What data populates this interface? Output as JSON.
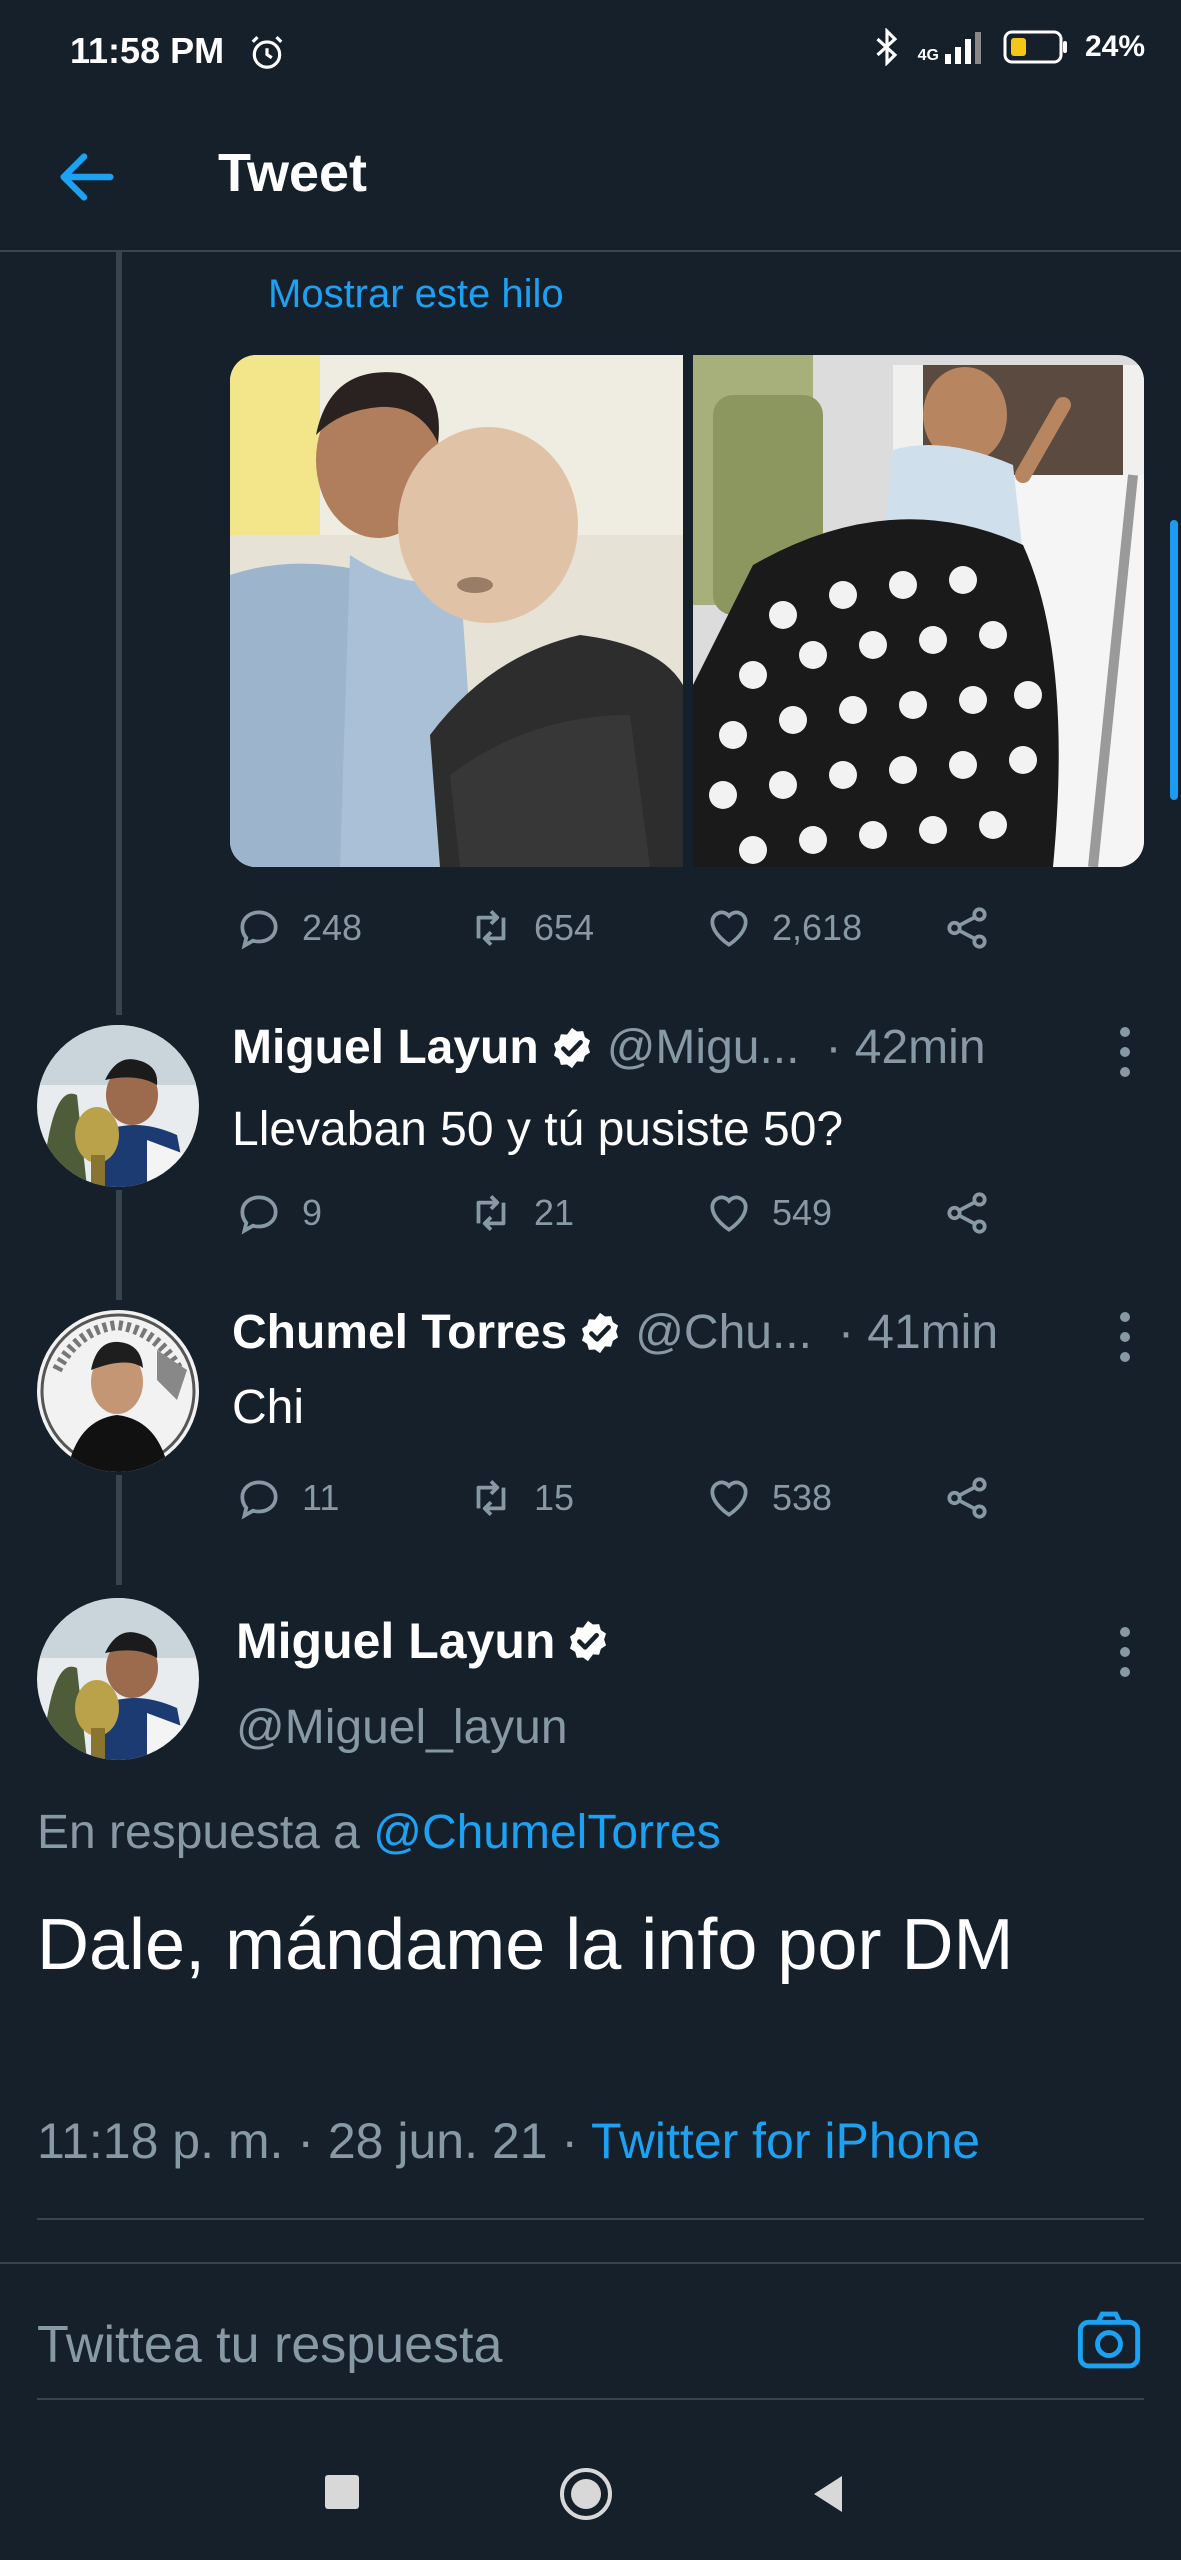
{
  "status_bar": {
    "time": "11:58 PM",
    "network": "4G",
    "battery": "24%"
  },
  "header": {
    "title": "Tweet"
  },
  "thread": {
    "show_thread_label": "Mostrar este hilo",
    "stats": {
      "replies": "248",
      "retweets": "654",
      "likes": "2,618"
    }
  },
  "replies": [
    {
      "name": "Miguel Layun",
      "handle": "@Migu...",
      "time": "· 42min",
      "text": "Llevaban 50 y tú pusiste 50?",
      "stats": {
        "replies": "9",
        "retweets": "21",
        "likes": "549"
      }
    },
    {
      "name": "Chumel Torres",
      "handle": "@Chu...",
      "time": "· 41min",
      "text": "Chi",
      "stats": {
        "replies": "11",
        "retweets": "15",
        "likes": "538"
      }
    }
  ],
  "main_tweet": {
    "name": "Miguel Layun",
    "handle": "@Miguel_layun",
    "in_reply_prefix": "En respuesta a",
    "in_reply_handle": "@ChumelTorres",
    "text": "Dale, mándame la info por DM",
    "timestamp": "11:18 p. m. · 28 jun. 21 · ",
    "source": "Twitter for iPhone"
  },
  "compose": {
    "placeholder": "Twittea tu respuesta"
  },
  "colors": {
    "background": "#15202b",
    "accent": "#1da1f2",
    "muted": "#8899a6",
    "divider": "#38444d"
  }
}
